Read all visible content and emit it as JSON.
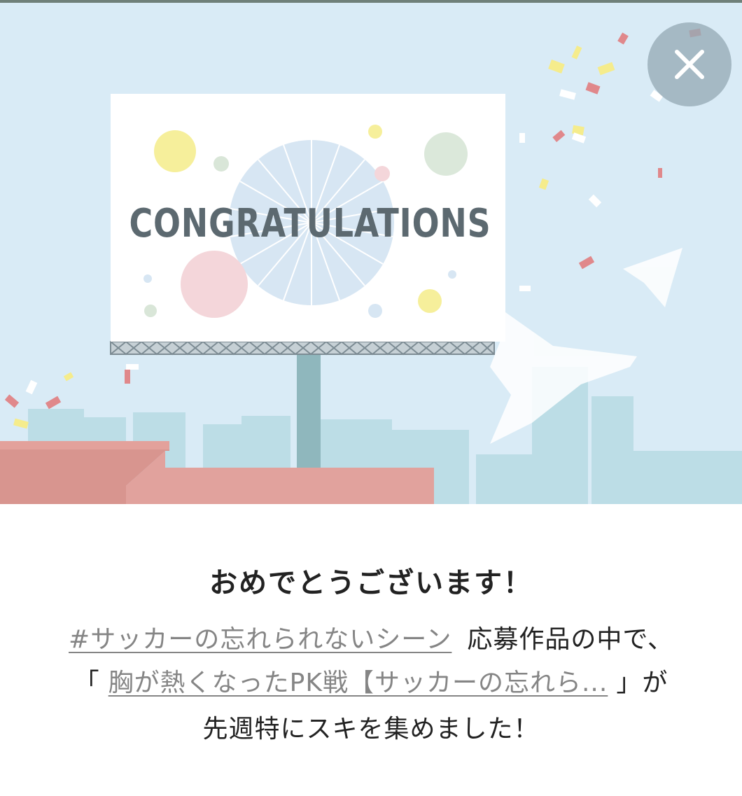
{
  "hero": {
    "billboard_text": "CONGRATULATIONS"
  },
  "close_button": {
    "icon": "close-icon"
  },
  "dialog": {
    "headline": "おめでとうございます！",
    "hashtag_link": "#サッカーの忘れられないシーン",
    "after_hashtag": "応募作品の中で、",
    "open_bracket": "「",
    "article_link": "胸が熱くなったPK戦【サッカーの忘れら...",
    "close_bracket": "」が",
    "last_line": "先週特にスキを集めました！"
  }
}
